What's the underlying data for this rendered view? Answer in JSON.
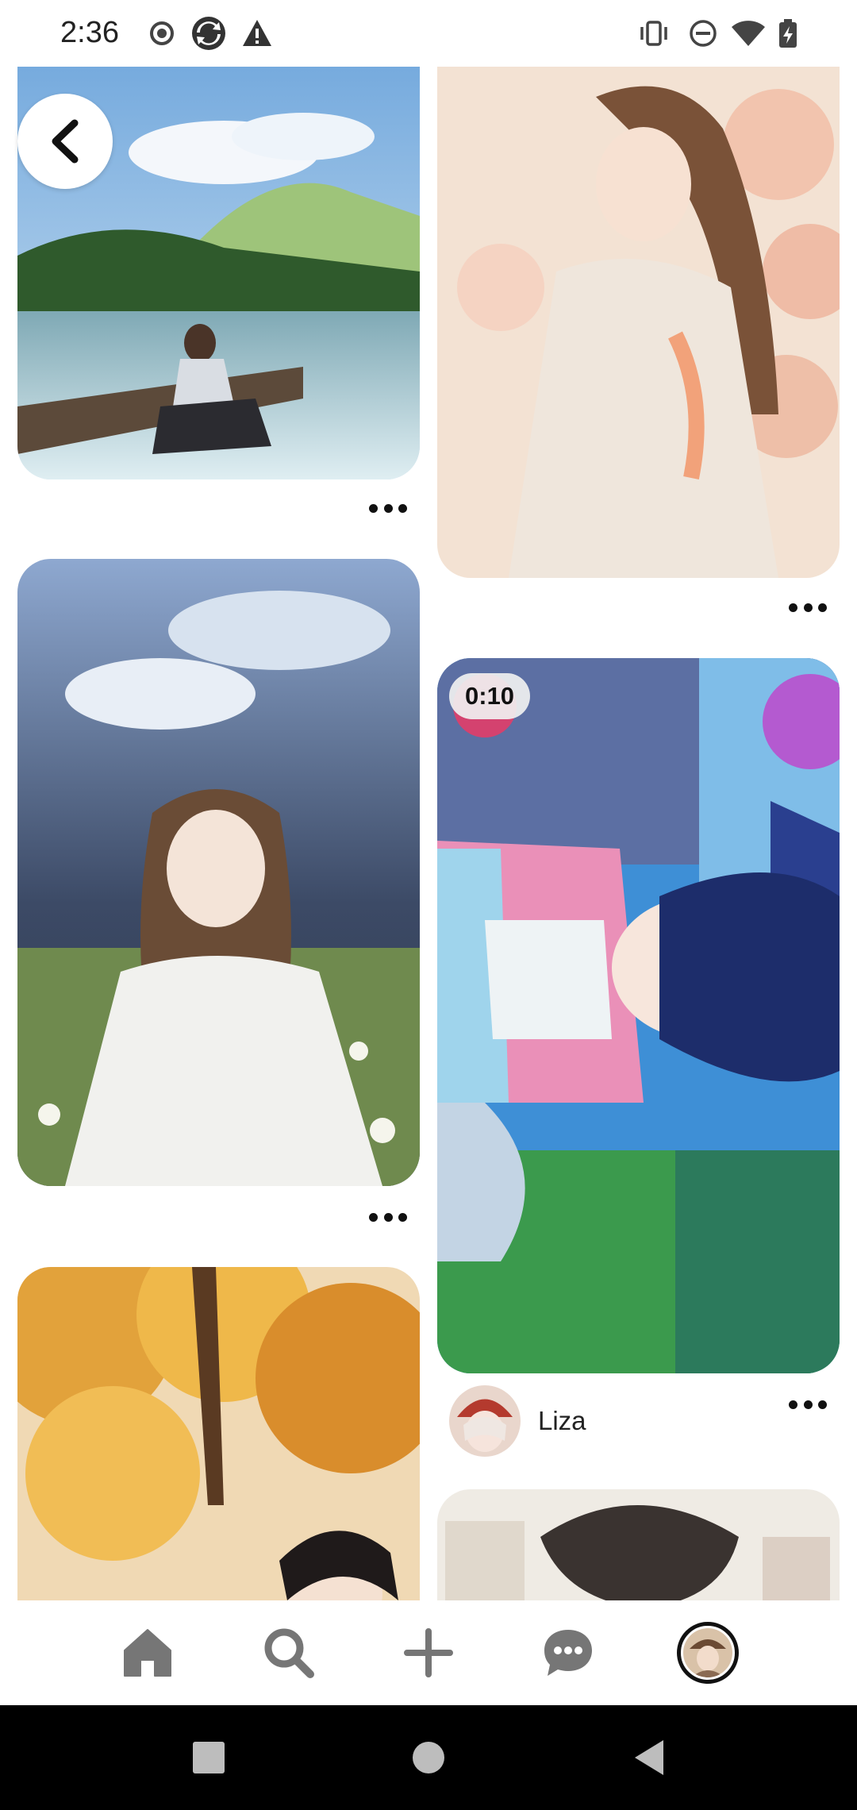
{
  "status_bar": {
    "time": "2:36",
    "left_icons": [
      "record-icon",
      "sync-icon",
      "warning-icon"
    ],
    "right_icons": [
      "vibrate-icon",
      "do-not-disturb-icon",
      "wifi-icon",
      "battery-charging-icon"
    ]
  },
  "feed": {
    "pins": [
      {
        "id": "pin-lake-girl",
        "column": "left",
        "has_more_menu": true
      },
      {
        "id": "pin-flower-princess",
        "column": "right",
        "has_more_menu": true
      },
      {
        "id": "pin-meadow-girl",
        "column": "left",
        "has_more_menu": true
      },
      {
        "id": "pin-video-hanfu",
        "column": "right",
        "has_more_menu": true,
        "duration": "0:10",
        "creator": "Liza"
      },
      {
        "id": "pin-autumn-tree",
        "column": "left",
        "has_more_menu": false
      },
      {
        "id": "pin-sketch-boy",
        "column": "right",
        "has_more_menu": false
      }
    ]
  },
  "back_button": {
    "icon": "chevron-left-icon"
  },
  "bottom_nav": {
    "items": [
      {
        "name": "home",
        "icon": "home-icon"
      },
      {
        "name": "search",
        "icon": "search-icon"
      },
      {
        "name": "create",
        "icon": "plus-icon"
      },
      {
        "name": "messages",
        "icon": "chat-icon"
      },
      {
        "name": "profile",
        "icon": "avatar"
      }
    ]
  },
  "system_nav": {
    "buttons": [
      "recents-button",
      "home-button",
      "back-button"
    ]
  }
}
